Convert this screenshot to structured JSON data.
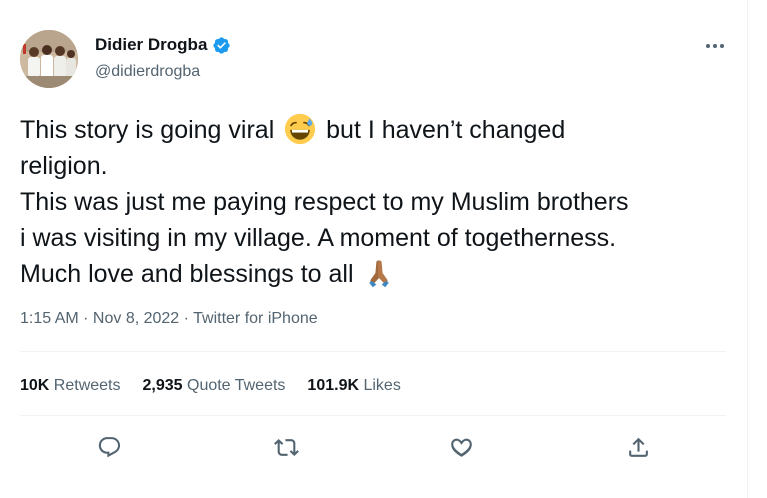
{
  "author": {
    "display_name": "Didier Drogba",
    "handle": "@didierdrogba",
    "verified": true,
    "avatar_icon": "group-photo-avatar"
  },
  "tweet": {
    "line1_before_emoji": "This story is going viral ",
    "line1_emoji": "grinning-face-with-sweat-emoji",
    "line1_after_emoji": " but I haven’t changed",
    "line2": "religion.",
    "line3": "This was just me paying respect to my Muslim brothers",
    "line4": "i was visiting in my village. A moment of togetherness.",
    "line5_before_emoji": "Much love and blessings to all ",
    "line5_emoji": "folded-hands-emoji"
  },
  "meta": {
    "time": "1:15 AM",
    "separator": " · ",
    "date": "Nov 8, 2022",
    "source": "Twitter for iPhone"
  },
  "stats": {
    "retweets_count": "10K",
    "retweets_label": " Retweets",
    "quotes_count": "2,935",
    "quotes_label": " Quote Tweets",
    "likes_count": "101.9K",
    "likes_label": " Likes"
  },
  "actions": {
    "reply": "reply-icon",
    "retweet": "retweet-icon",
    "like": "like-icon",
    "share": "share-icon"
  },
  "colors": {
    "text_primary": "#0f1419",
    "text_secondary": "#536471",
    "verified_blue": "#1d9bf0",
    "divider": "#eff3f4"
  }
}
